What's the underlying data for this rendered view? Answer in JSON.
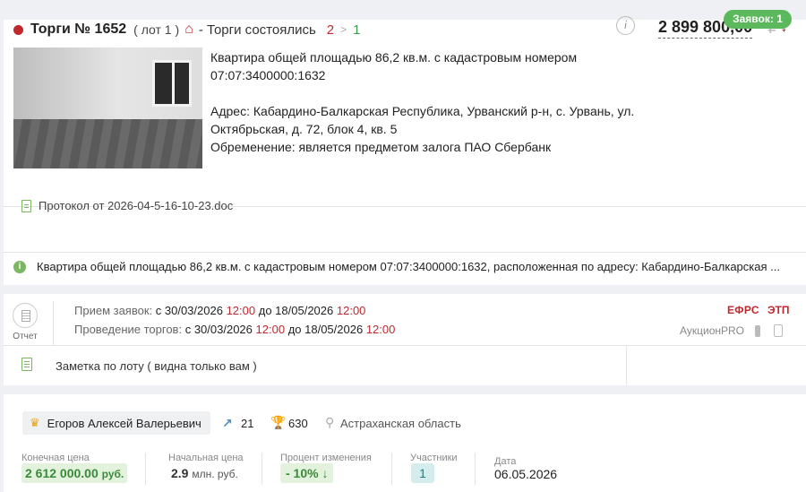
{
  "lot": {
    "applications_badge": "Заявок:  1",
    "title": "Торги № 1652",
    "lot_number": "( лот 1 )",
    "status": "- Торги состоялись",
    "count_red": "2",
    "count_sep": ">",
    "count_green": "1",
    "price": "2 899 800,00",
    "currency": "₽",
    "price_direction": "↓",
    "info_icon": "i",
    "description_line1": "Квартира общей площадью 86,2 кв.м. с кадастровым номером",
    "description_line2": "07:07:3400000:1632",
    "address_line1": "Адрес: Кабардино-Балкарская Республика, Урванский р-н, с. Урвань, ул.",
    "address_line2": "Октябрьская, д. 72, блок 4, кв. 5",
    "encumbrance": "Обременение: является предметом залога ПАО Сбербанк",
    "protocol": "Протокол от 2026-04-5-16-10-23.doc",
    "summary": "Квартира общей площадью 86,2 кв.м. с кадастровым номером 07:07:3400000:1632, расположенная по адресу: Кабардино-Балкарская ..."
  },
  "schedule": {
    "report_label": "Отчет",
    "applications_label": "Прием заявок:",
    "applications_from": "с 30/03/2026",
    "applications_from_time": "12:00",
    "applications_to": "до 18/05/2026",
    "applications_to_time": "12:00",
    "trading_label": "Проведение торгов:",
    "trading_from": "с 30/03/2026",
    "trading_from_time": "12:00",
    "trading_to": "до 18/05/2026",
    "trading_to_time": "12:00",
    "efrs": "ЕФРС",
    "etp": "ЭТП",
    "platform": "АукционPRO",
    "note": "Заметка по лоту ( видна только вам )"
  },
  "result": {
    "winner": "Егоров Алексей Валерьевич",
    "stat1": "21",
    "stat2": "630",
    "region": "Астраханская область",
    "final_price_label": "Конечная цена",
    "final_price": "2 612 000.00",
    "final_price_unit": "руб.",
    "start_price_label": "Начальная цена",
    "start_price": "2.9",
    "start_price_unit": "млн. руб.",
    "change_label": "Процент изменения",
    "change": "- 10%",
    "change_arrow": "↓",
    "participants_label": "Участники",
    "participants": "1",
    "date_label": "Дата",
    "date": "06.05.2026"
  },
  "colors": {
    "accent_red": "#c0282d",
    "accent_green": "#5cb85c"
  },
  "icons": [
    "home-icon",
    "info-icon",
    "doc-icon",
    "report-icon",
    "note-icon",
    "crown-icon",
    "chart-icon",
    "trophy-icon",
    "pin-icon"
  ]
}
